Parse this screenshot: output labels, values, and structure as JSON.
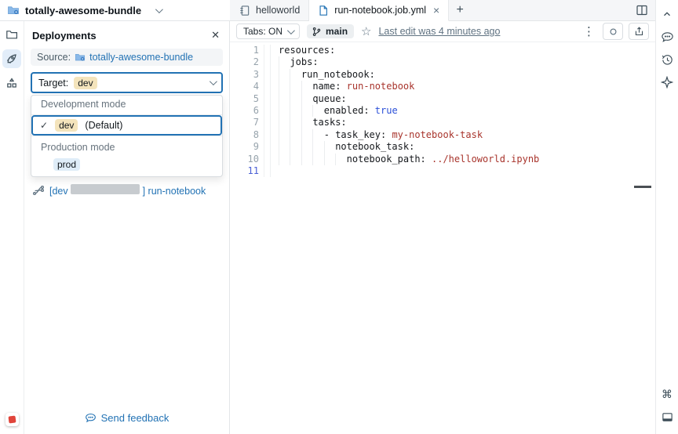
{
  "colors": {
    "accent_blue": "#2272b4",
    "link_blue": "#2272b4",
    "dev_badge_bg": "#f4e4bc",
    "prod_badge_bg": "#dfedf8",
    "yaml_string_red": "#a8342c",
    "yaml_bool_blue": "#2b50d8"
  },
  "glyphs": {
    "kebab": "⋮",
    "command": "⌘",
    "star": "☆",
    "panel_close": "✕",
    "tab_close": "×",
    "plus": "+",
    "check": "✓"
  },
  "top_bar": {
    "bundle_name": "totally-awesome-bundle"
  },
  "panel": {
    "title": "Deployments",
    "source_label": "Source:",
    "source_link": "totally-awesome-bundle",
    "target_label": "Target:",
    "target_value": "dev",
    "dropdown": {
      "groups": [
        {
          "header": "Development mode",
          "items": [
            {
              "label": "dev",
              "suffix": "(Default)",
              "selected": true
            }
          ]
        },
        {
          "header": "Production mode",
          "items": [
            {
              "label": "prod",
              "selected": false
            }
          ]
        }
      ]
    },
    "run_link": {
      "prefix": "[dev",
      "suffix": "] run-notebook",
      "redacted": true
    },
    "feedback_label": "Send feedback"
  },
  "editor": {
    "tabs": [
      {
        "label": "helloworld",
        "icon": "notebook-icon",
        "active": false
      },
      {
        "label": "run-notebook.job.yml",
        "icon": "file-icon",
        "active": true,
        "closable": true
      }
    ],
    "toolbar": {
      "tabs_toggle": "Tabs: ON",
      "branch": "main",
      "last_edit": "Last edit was 4 minutes ago"
    },
    "code": {
      "language": "yaml",
      "lines": [
        {
          "num": 1,
          "indent": 0,
          "tokens": [
            {
              "c": "key",
              "t": "resources:"
            }
          ]
        },
        {
          "num": 2,
          "indent": 1,
          "tokens": [
            {
              "c": "key",
              "t": "jobs:"
            }
          ]
        },
        {
          "num": 3,
          "indent": 2,
          "tokens": [
            {
              "c": "key",
              "t": "run_notebook:"
            }
          ]
        },
        {
          "num": 4,
          "indent": 3,
          "tokens": [
            {
              "c": "key",
              "t": "name: "
            },
            {
              "c": "str",
              "t": "run-notebook"
            }
          ]
        },
        {
          "num": 5,
          "indent": 3,
          "tokens": [
            {
              "c": "key",
              "t": "queue:"
            }
          ]
        },
        {
          "num": 6,
          "indent": 4,
          "tokens": [
            {
              "c": "key",
              "t": "enabled: "
            },
            {
              "c": "bool",
              "t": "true"
            }
          ]
        },
        {
          "num": 7,
          "indent": 3,
          "tokens": [
            {
              "c": "key",
              "t": "tasks:"
            }
          ]
        },
        {
          "num": 8,
          "indent": 4,
          "tokens": [
            {
              "c": "key",
              "t": "- task_key: "
            },
            {
              "c": "str",
              "t": "my-notebook-task"
            }
          ]
        },
        {
          "num": 9,
          "indent": 5,
          "tokens": [
            {
              "c": "key",
              "t": "notebook_task:"
            }
          ]
        },
        {
          "num": 10,
          "indent": 6,
          "tokens": [
            {
              "c": "key",
              "t": "notebook_path: "
            },
            {
              "c": "str",
              "t": "../helloworld.ipynb"
            }
          ]
        },
        {
          "num": 11,
          "indent": 0,
          "active": true,
          "tokens": []
        }
      ]
    }
  }
}
